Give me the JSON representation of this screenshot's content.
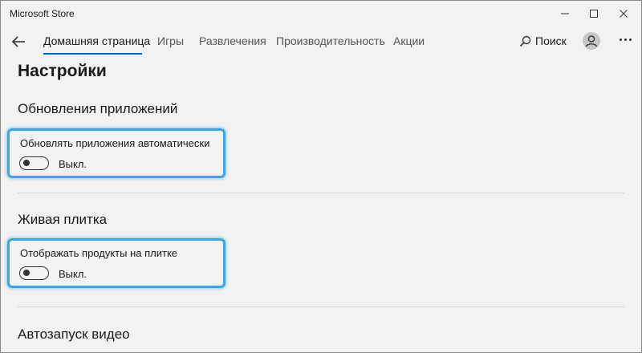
{
  "window": {
    "title": "Microsoft Store",
    "controls": [
      "minimize-icon",
      "maximize-icon",
      "close-icon"
    ]
  },
  "nav": {
    "back_icon": "arrow-left-icon",
    "tabs": [
      {
        "label": "Домашняя страница",
        "active": true
      },
      {
        "label": "Игры",
        "active": false
      },
      {
        "label": "Развлечения",
        "active": false
      },
      {
        "label": "Производительность",
        "active": false
      },
      {
        "label": "Акции",
        "active": false
      }
    ],
    "search_label": "Поиск",
    "search_icon": "search-icon",
    "avatar_icon": "user-icon",
    "more_icon": "more-icon"
  },
  "settings": {
    "page_title": "Настройки",
    "sections": [
      {
        "title": "Обновления приложений",
        "setting_label": "Обновлять приложения автоматически",
        "toggle_state": "Выкл.",
        "toggle_on": false
      },
      {
        "title": "Живая плитка",
        "setting_label": "Отображать продукты на плитке",
        "toggle_state": "Выкл.",
        "toggle_on": false
      },
      {
        "title": "Автозапуск видео"
      }
    ]
  },
  "colors": {
    "accent": "#0067c0",
    "highlight_border": "#3aa8df",
    "background": "#f2f2f2"
  }
}
